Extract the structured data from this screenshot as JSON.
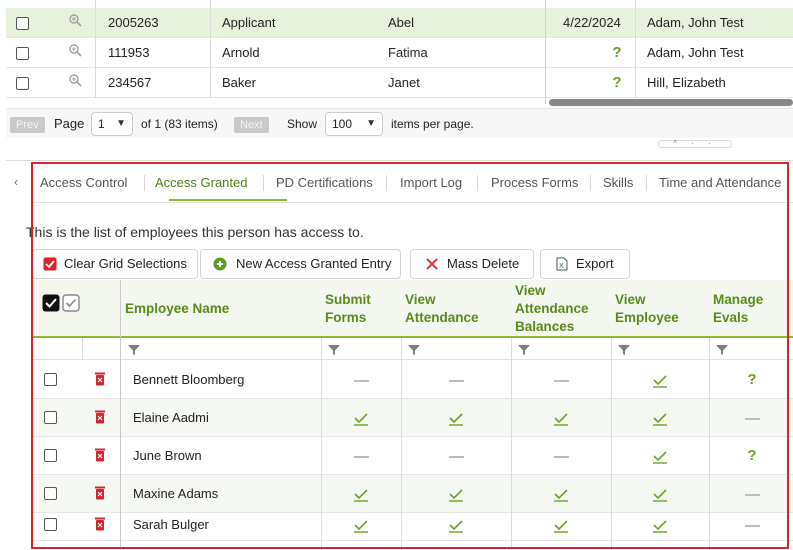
{
  "top_grid": {
    "rows": [
      {
        "id": "2005263",
        "last": "Applicant",
        "first": "Abel",
        "date": "4/22/2024",
        "status": "",
        "supervisor": "Adam, John Test",
        "selected": true
      },
      {
        "id": "111953",
        "last": "Arnold",
        "first": "Fatima",
        "date": "",
        "status": "?",
        "supervisor": "Adam, John Test",
        "selected": false
      },
      {
        "id": "234567",
        "last": "Baker",
        "first": "Janet",
        "date": "",
        "status": "?",
        "supervisor": "Hill, Elizabeth",
        "selected": false
      }
    ]
  },
  "pager": {
    "prev_label": "Prev",
    "page_label": "Page",
    "page_value": "1",
    "of_label": "of 1 (83 items)",
    "next_label": "Next",
    "show_label": "Show",
    "per_page_value": "100",
    "items_per_page_label": "items per page."
  },
  "tabs": [
    {
      "label": "Access Control",
      "active": false
    },
    {
      "label": "Access Granted",
      "active": true
    },
    {
      "label": "PD Certifications",
      "active": false
    },
    {
      "label": "Import Log",
      "active": false
    },
    {
      "label": "Process Forms",
      "active": false
    },
    {
      "label": "Skills",
      "active": false
    },
    {
      "label": "Time and Attendance",
      "active": false
    }
  ],
  "description": "This is the list of employees this person has access to.",
  "toolbar": {
    "clear_label": "Clear Grid Selections",
    "new_label": "New Access Granted Entry",
    "delete_label": "Mass Delete",
    "export_label": "Export"
  },
  "grid": {
    "columns": {
      "employee_name": "Employee Name",
      "submit_forms": [
        "Submit",
        "Forms"
      ],
      "view_attendance": [
        "View",
        "Attendance"
      ],
      "view_balances": [
        "View",
        "Attendance",
        "Balances"
      ],
      "view_employee": [
        "View",
        "Employee"
      ],
      "manage_evals": [
        "Manage",
        "Evals"
      ]
    },
    "rows": [
      {
        "name": "Bennett Bloomberg",
        "submit": "dash",
        "attendance": "dash",
        "balances": "dash",
        "employee": "check",
        "evals": "question"
      },
      {
        "name": "Elaine Aadmi",
        "submit": "check",
        "attendance": "check",
        "balances": "check",
        "employee": "check",
        "evals": "dash"
      },
      {
        "name": "June Brown",
        "submit": "dash",
        "attendance": "dash",
        "balances": "dash",
        "employee": "check",
        "evals": "question"
      },
      {
        "name": "Maxine Adams",
        "submit": "check",
        "attendance": "check",
        "balances": "check",
        "employee": "check",
        "evals": "dash"
      },
      {
        "name": "Sarah Bulger",
        "submit": "check",
        "attendance": "check",
        "balances": "check",
        "employee": "check",
        "evals": "dash"
      }
    ]
  },
  "colors": {
    "accent_green": "#6aa121",
    "header_green": "#5a8a1a",
    "highlight_red": "#d9232a"
  }
}
